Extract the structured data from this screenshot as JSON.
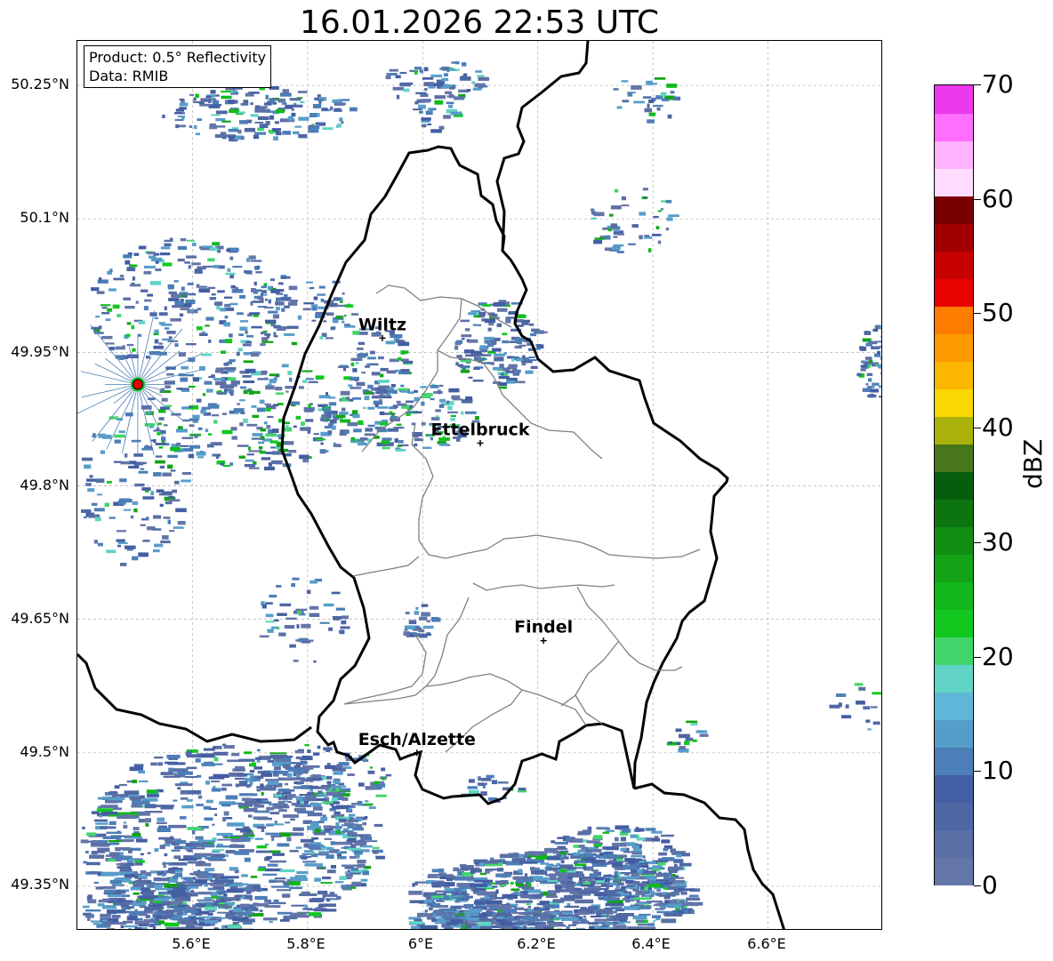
{
  "title": "16.01.2026 22:53 UTC",
  "info": {
    "product": "Product: 0.5° Reflectivity",
    "data": "Data: RMIB"
  },
  "lat_labels": [
    "50.25°N",
    "50.1°N",
    "49.95°N",
    "49.8°N",
    "49.65°N",
    "49.5°N",
    "49.35°N"
  ],
  "lon_labels": [
    "5.6°E",
    "5.8°E",
    "6°E",
    "6.2°E",
    "6.4°E",
    "6.6°E"
  ],
  "cities": [
    {
      "name": "Wiltz",
      "lon": 5.93,
      "lat": 49.966
    },
    {
      "name": "Ettelbruck",
      "lon": 6.1,
      "lat": 49.848
    },
    {
      "name": "Findel",
      "lon": 6.21,
      "lat": 49.626
    },
    {
      "name": "Esch/Alzette",
      "lon": 5.99,
      "lat": 49.5
    }
  ],
  "radar_site": {
    "lon": 5.505,
    "lat": 49.914,
    "color": "#e8000b"
  },
  "extent": {
    "lon_min": 5.4,
    "lon_max": 6.8,
    "lat_min": 49.3,
    "lat_max": 50.3
  },
  "colorbar": {
    "unit": "dBZ",
    "tick_labels": [
      "0",
      "10",
      "20",
      "30",
      "40",
      "50",
      "60",
      "70"
    ],
    "vmin": 0,
    "vmax": 70,
    "colors": [
      "#6475a8",
      "#5a6fa5",
      "#4f67a4",
      "#435ea2",
      "#4c7eb7",
      "#579dca",
      "#5fb7d9",
      "#60d3c4",
      "#42d56c",
      "#12c81f",
      "#12b81b",
      "#12a416",
      "#0f8e12",
      "#0c7510",
      "#065e0d",
      "#47771a",
      "#aab10a",
      "#f9d700",
      "#fbb600",
      "#fd9b00",
      "#fe7d00",
      "#e90000",
      "#c70000",
      "#a20000",
      "#7a0000",
      "#ffdcff",
      "#ffb3ff",
      "#ff6eff",
      "#eb39eb"
    ]
  }
}
